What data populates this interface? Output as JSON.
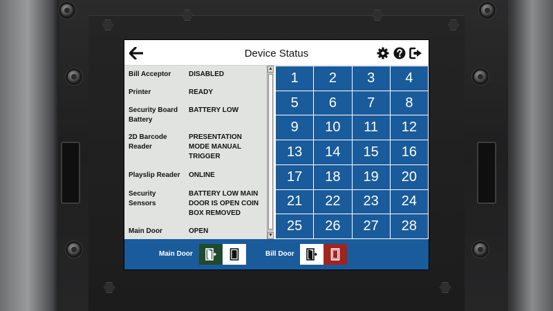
{
  "header": {
    "title": "Device Status",
    "back_icon": "arrow-left-icon",
    "settings_icon": "gear-icon",
    "help_icon": "question-circle-icon",
    "logout_icon": "sign-out-icon"
  },
  "status": {
    "rows": [
      {
        "label": "Bill Acceptor",
        "value": "DISABLED"
      },
      {
        "label": "Printer",
        "value": "READY"
      },
      {
        "label": "Security Board Battery",
        "value": "BATTERY LOW"
      },
      {
        "label": "2D Barcode Reader",
        "value": "PRESENTATION MODE MANUAL TRIGGER"
      },
      {
        "label": "Playslip Reader",
        "value": "ONLINE"
      },
      {
        "label": "Security Sensors",
        "value": "BATTERY LOW MAIN DOOR IS OPEN COIN BOX REMOVED"
      },
      {
        "label": "Main Door",
        "value": "OPEN"
      }
    ]
  },
  "grid": {
    "numbers": [
      "1",
      "2",
      "3",
      "4",
      "5",
      "6",
      "7",
      "8",
      "9",
      "10",
      "11",
      "12",
      "13",
      "14",
      "15",
      "16",
      "17",
      "18",
      "19",
      "20",
      "21",
      "22",
      "23",
      "24",
      "25",
      "26",
      "27",
      "28"
    ]
  },
  "footer": {
    "main_door_label": "Main Door",
    "bill_door_label": "Bill Door"
  },
  "colors": {
    "primary_blue": "#1a5b9c",
    "main_door_open_green": "#1f4a2e",
    "bill_door_red": "#a3231f",
    "panel_gray": "#e1e3e1"
  }
}
